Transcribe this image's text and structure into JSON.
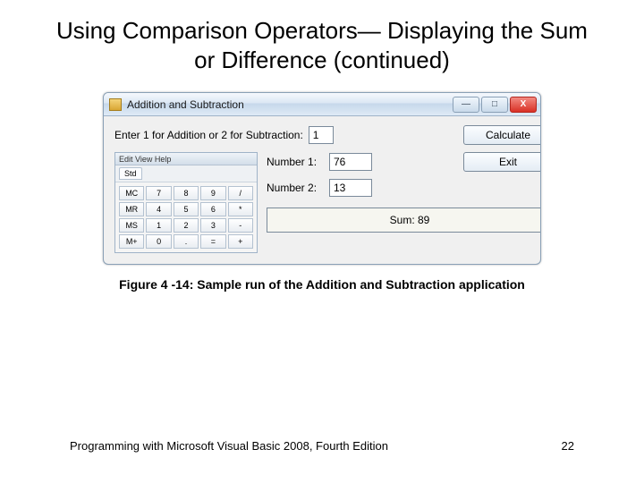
{
  "slide": {
    "title": "Using Comparison Operators— Displaying the Sum or Difference (continued)",
    "caption": "Figure 4 -14: Sample run of the Addition and Subtraction application",
    "footer_left": "Programming with Microsoft Visual Basic 2008, Fourth Edition",
    "footer_right": "22"
  },
  "window": {
    "title": "Addition and Subtraction",
    "prompt": "Enter 1 for Addition or 2 for Subtraction:",
    "choice_value": "1",
    "num1_label": "Number 1:",
    "num1_value": "76",
    "num2_label": "Number 2:",
    "num2_value": "13",
    "calc_label": "Calculate",
    "exit_label": "Exit",
    "result": "Sum: 89",
    "min_symbol": "—",
    "max_symbol": "□",
    "close_symbol": "X",
    "keypad": {
      "title": "Edit View Help",
      "tabs": [
        "Std"
      ],
      "keys": [
        "MC",
        "7",
        "8",
        "9",
        "/",
        "MR",
        "4",
        "5",
        "6",
        "*",
        "MS",
        "1",
        "2",
        "3",
        "-",
        "M+",
        "0",
        ".",
        "=",
        "+"
      ]
    }
  }
}
